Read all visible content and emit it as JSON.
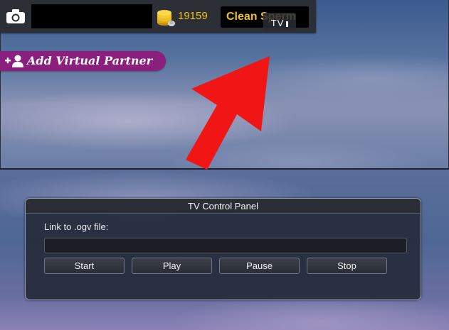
{
  "hud": {
    "camera_icon": "camera-icon",
    "coin_icon": "coin-stack-icon",
    "coins": "19159",
    "clean_label": "Clean Sperm",
    "tv_label": "TV",
    "tv_indicator_icon": "tv-indicator-bar",
    "accent_gold": "#f2c316"
  },
  "partner": {
    "label": "Add Virtual Partner",
    "icon": "add-person-icon",
    "color": "#8a1f7e"
  },
  "pointer": {
    "icon": "red-arrow-icon",
    "color": "#f01616"
  },
  "tv_panel": {
    "title": "TV Control Panel",
    "link_label": "Link to .ogv file:",
    "link_value": "",
    "buttons": {
      "start": "Start",
      "play": "Play",
      "pause": "Pause",
      "stop": "Stop"
    }
  }
}
